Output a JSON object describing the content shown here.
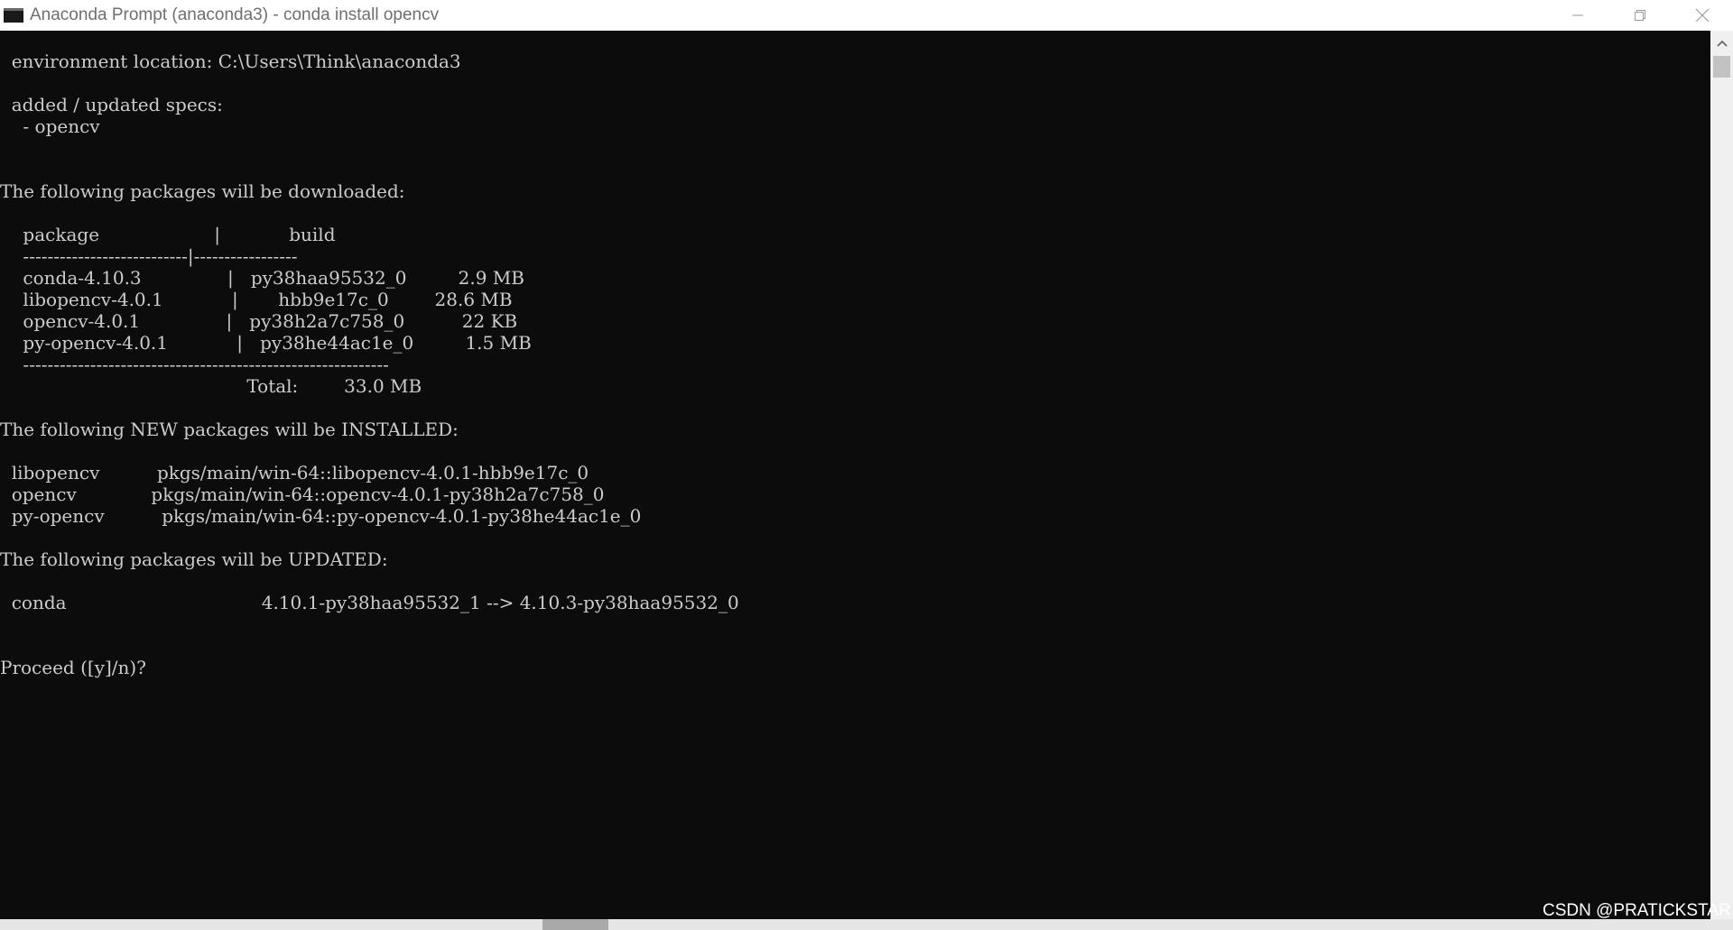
{
  "window": {
    "title": "Anaconda Prompt (anaconda3) - conda  install opencv",
    "icon": "terminal-icon",
    "controls": [
      "minimize-icon",
      "restore-icon",
      "close-icon"
    ]
  },
  "terminal": {
    "lines": [
      "  environment location: C:\\Users\\Think\\anaconda3",
      "",
      "  added / updated specs:",
      "    - opencv",
      "",
      "",
      "The following packages will be downloaded:",
      "",
      "    package                    |            build",
      "    ---------------------------|-----------------",
      "    conda-4.10.3               |   py38haa95532_0         2.9 MB",
      "    libopencv-4.0.1            |       hbb9e17c_0        28.6 MB",
      "    opencv-4.0.1               |   py38h2a7c758_0          22 KB",
      "    py-opencv-4.0.1            |   py38he44ac1e_0         1.5 MB",
      "    ------------------------------------------------------------",
      "                                           Total:        33.0 MB",
      "",
      "The following NEW packages will be INSTALLED:",
      "",
      "  libopencv          pkgs/main/win-64::libopencv-4.0.1-hbb9e17c_0",
      "  opencv             pkgs/main/win-64::opencv-4.0.1-py38h2a7c758_0",
      "  py-opencv          pkgs/main/win-64::py-opencv-4.0.1-py38he44ac1e_0",
      "",
      "The following packages will be UPDATED:",
      "",
      "  conda                                  4.10.1-py38haa95532_1 --> 4.10.3-py38haa95532_0",
      "",
      "",
      "Proceed ([y]/n)?"
    ]
  },
  "watermark": "CSDN @PRATICKSTAR",
  "colors": {
    "terminal_bg": "#0c0c0c",
    "terminal_text": "#cccccc",
    "titlebar_bg": "#ffffff",
    "title_text": "#6f6f6f"
  }
}
